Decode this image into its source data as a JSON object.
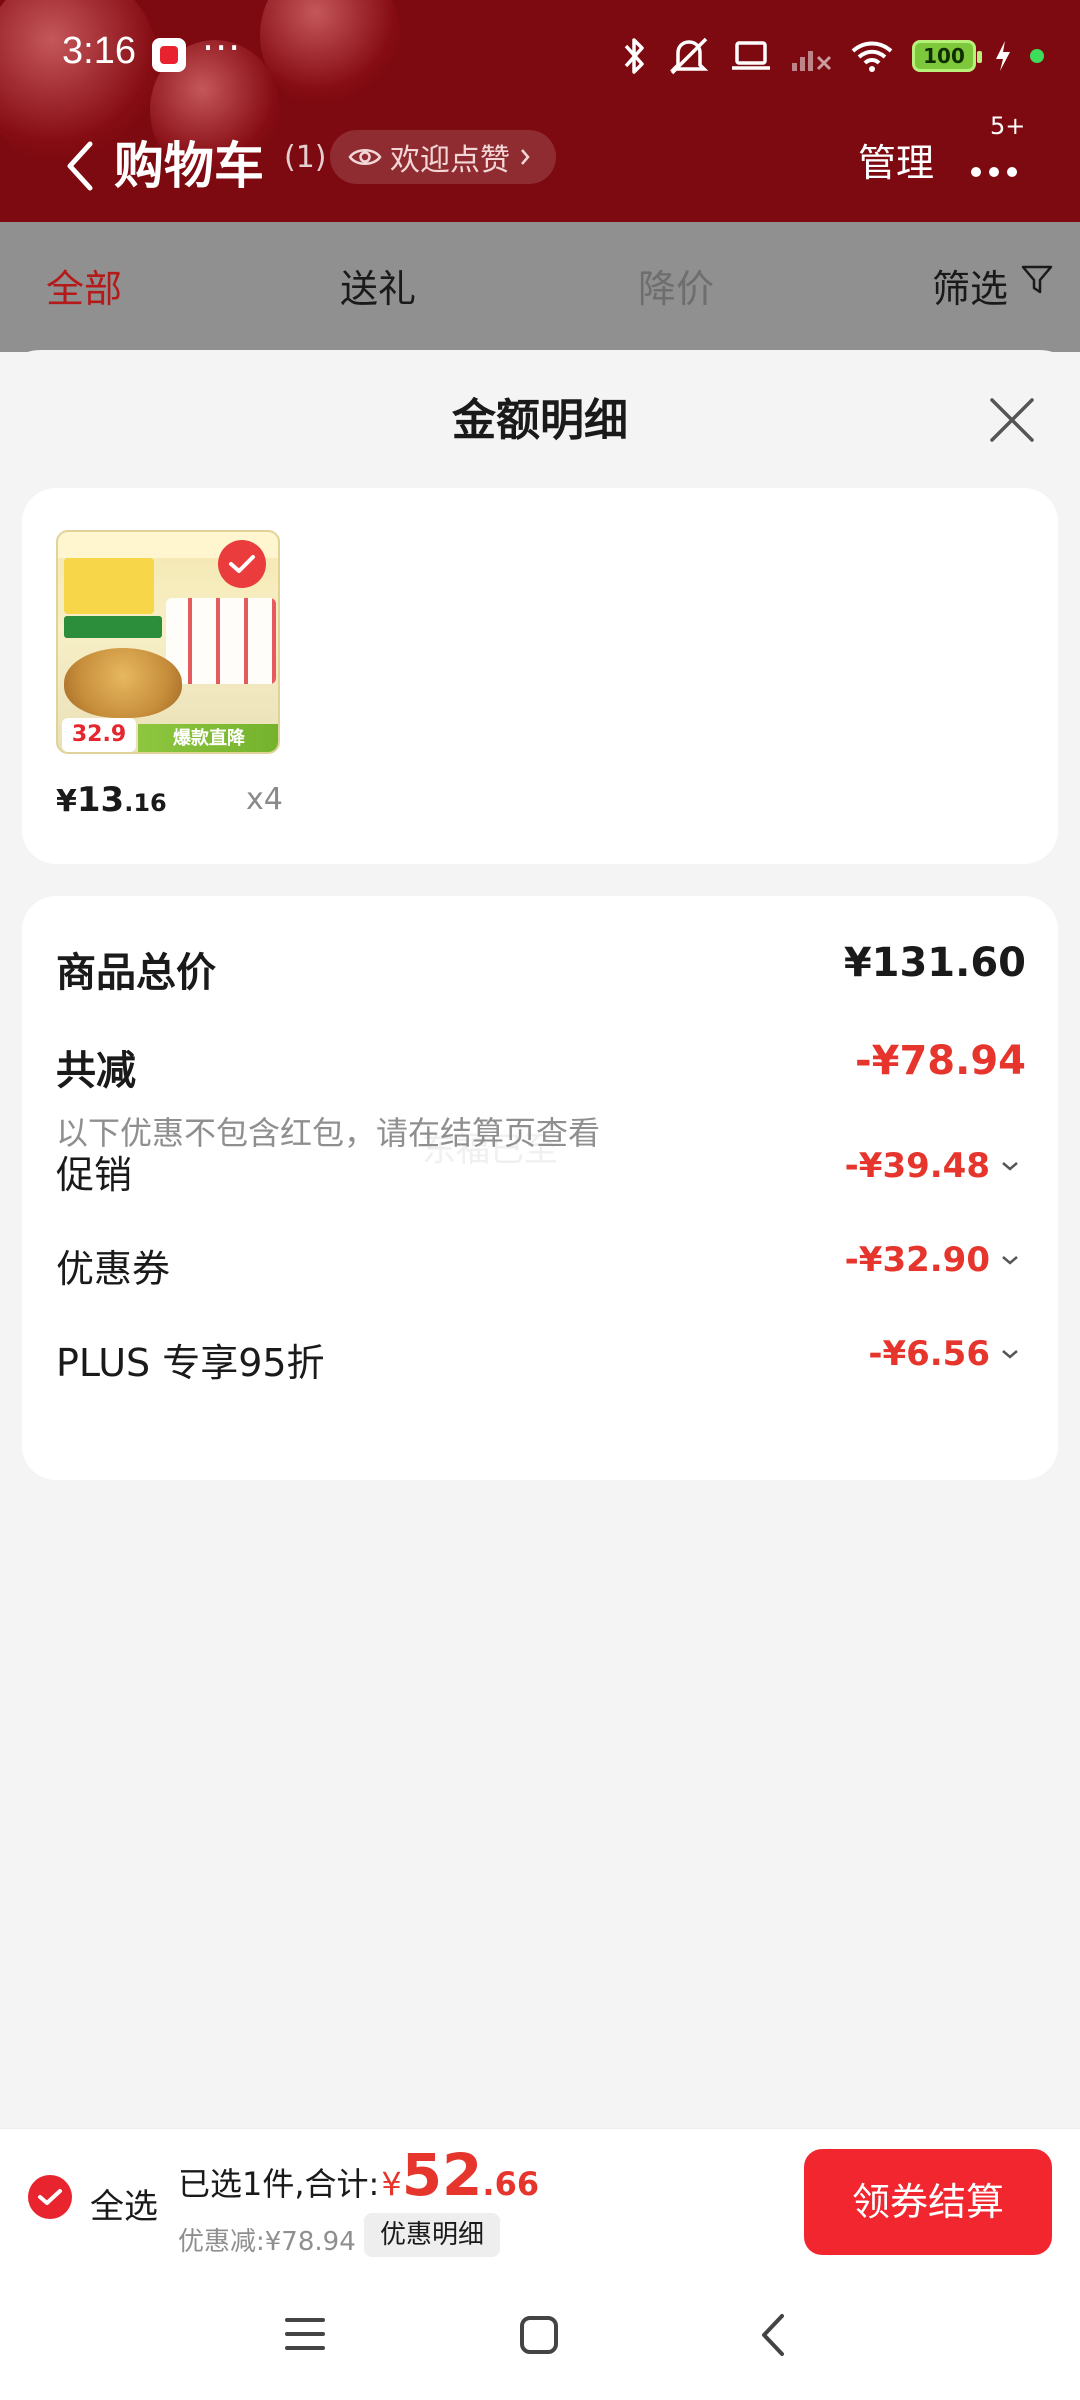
{
  "status": {
    "time": "3:16",
    "more": "···",
    "battery": "100"
  },
  "nav": {
    "title": "购物车",
    "count": "(1)",
    "like_label": "欢迎点赞",
    "manage": "管理",
    "more_badge": "5+"
  },
  "tabs": {
    "all": "全部",
    "gift": "送礼",
    "price_drop": "降价",
    "filter": "筛选"
  },
  "sheet": {
    "title": "金额明细",
    "product": {
      "unit_price_symbol": "¥",
      "unit_price_int": "13",
      "unit_price_dec": ".16",
      "quantity": "x4",
      "thumb_price": "32.9",
      "thumb_ribbon": "爆款直降"
    },
    "total_label": "商品总价",
    "total_value": "¥131.60",
    "discount_label": "共减",
    "discount_value": "-¥78.94",
    "note": "以下优惠不包含红包，请在结算页查看",
    "watermark": "东福已至",
    "items": [
      {
        "label": "促销",
        "value": "-¥39.48"
      },
      {
        "label": "优惠券",
        "value": "-¥32.90"
      },
      {
        "label": "PLUS 专享95折",
        "value": "-¥6.56"
      }
    ]
  },
  "bottom": {
    "select_all": "全选",
    "selected_text": "已选1件,合计:",
    "total_symbol": "¥",
    "total_int": "52",
    "total_dec": ".66",
    "discount_text": "优惠减:¥78.94",
    "detail_button": "优惠明细",
    "checkout_button": "领券结算"
  },
  "colors": {
    "accent_red": "#e5352c",
    "header_bg": "#7d0a10",
    "checkout_red": "#f2262f"
  }
}
